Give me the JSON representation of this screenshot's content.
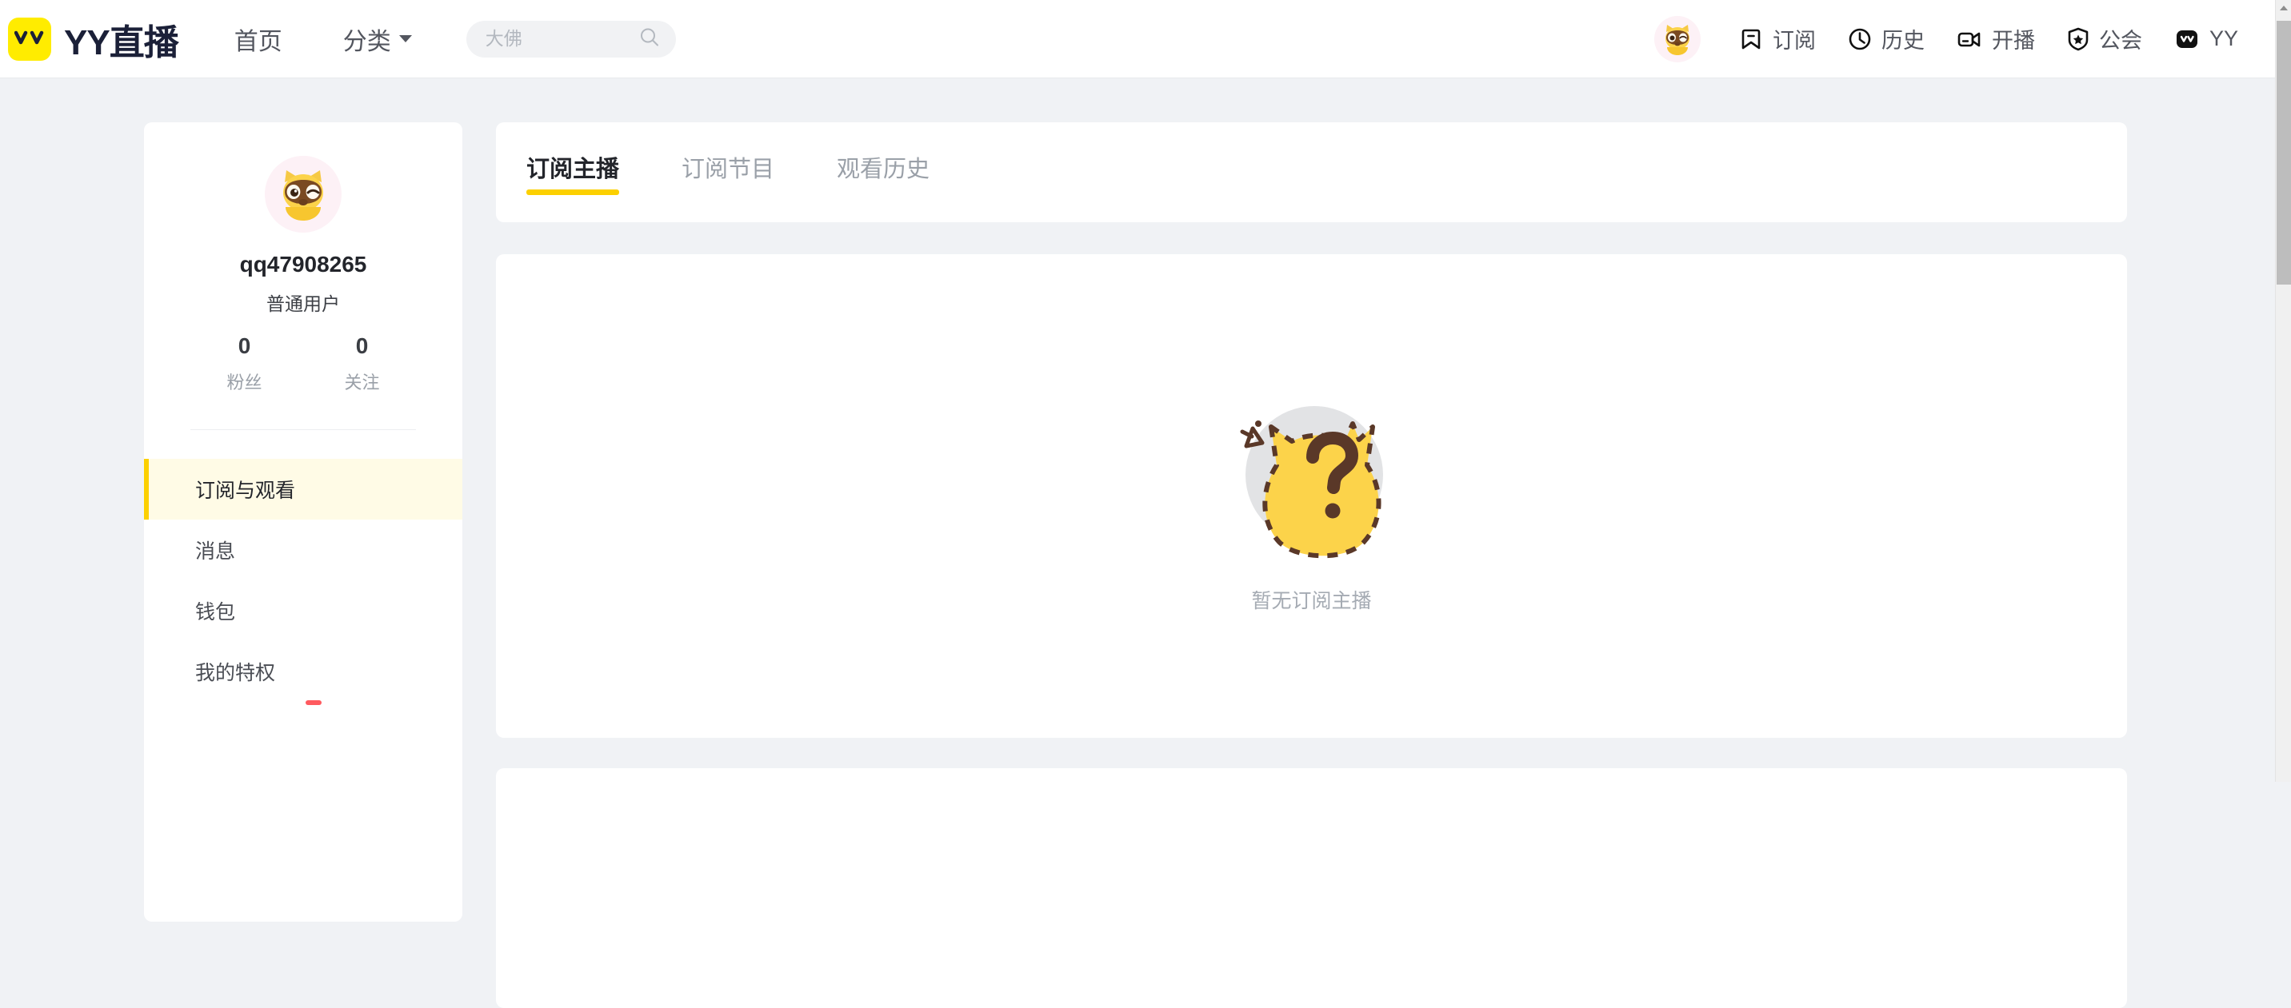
{
  "header": {
    "brand": {
      "logo_text": "YY",
      "title": "YY直播"
    },
    "nav": [
      {
        "label": "首页",
        "has_caret": false,
        "name": "nav-home"
      },
      {
        "label": "分类",
        "has_caret": true,
        "name": "nav-category"
      }
    ],
    "search": {
      "placeholder": "大佛",
      "value": "",
      "icon": "search-icon"
    },
    "avatar": {
      "icon": "user-avatar"
    },
    "right_items": [
      {
        "label": "订阅",
        "icon": "bookmark-icon",
        "name": "nav-subscriptions"
      },
      {
        "label": "历史",
        "icon": "clock-icon",
        "name": "nav-history"
      },
      {
        "label": "开播",
        "icon": "video-camera-icon",
        "name": "nav-golive"
      },
      {
        "label": "公会",
        "icon": "shield-star-icon",
        "name": "nav-guild"
      },
      {
        "label": "YY",
        "icon": "yy-app-icon",
        "name": "nav-yy-client"
      }
    ]
  },
  "sidebar": {
    "profile": {
      "username": "qq47908265",
      "role": "普通用户",
      "stats": [
        {
          "value": "0",
          "label": "粉丝"
        },
        {
          "value": "0",
          "label": "关注"
        }
      ]
    },
    "menu": [
      {
        "label": "订阅与观看",
        "active": true
      },
      {
        "label": "消息",
        "active": false
      },
      {
        "label": "钱包",
        "active": false
      },
      {
        "label": "我的特权",
        "active": false
      },
      {
        "label": "",
        "active": false
      }
    ]
  },
  "main": {
    "tabs": [
      {
        "label": "订阅主播",
        "active": true
      },
      {
        "label": "订阅节目",
        "active": false
      },
      {
        "label": "观看历史",
        "active": false
      }
    ],
    "empty_state": {
      "text": "暂无订阅主播",
      "illustration": "cat-question-mark-illustration"
    }
  },
  "scrollbar": {
    "up_arrow": "scroll-up-arrow"
  },
  "colors": {
    "brand_yellow": "#ffec00",
    "accent_yellow": "#fcd000",
    "active_bg": "#fffbe6",
    "page_bg": "#f0f2f5",
    "text_dark": "#23252b",
    "text_muted": "#9aa0a8"
  }
}
